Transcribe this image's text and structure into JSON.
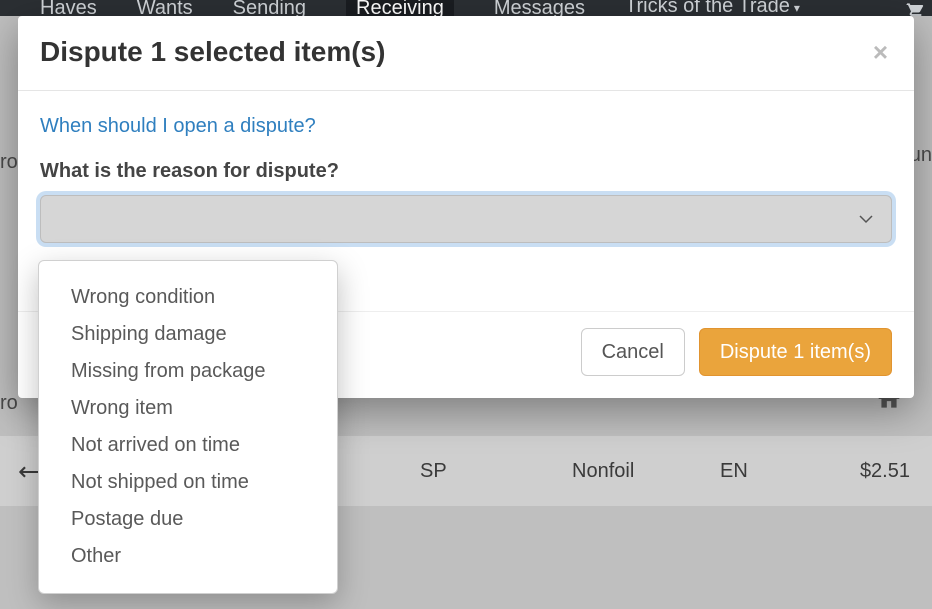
{
  "topnav": {
    "items": [
      "Haves",
      "Wants",
      "Sending",
      "Receiving",
      "Messages",
      "Tricks of the Trade"
    ],
    "active_index": 3,
    "dropdown_index": 5
  },
  "page": {
    "truncated_left_1": "ro",
    "truncated_left_2": "ro",
    "truncated_right_1": "un",
    "row": {
      "condition": "SP",
      "foil": "Nonfoil",
      "lang": "EN",
      "price": "$2.51"
    }
  },
  "modal": {
    "title": "Dispute 1 selected item(s)",
    "help_link": "When should I open a dispute?",
    "form_label": "What is the reason for dispute?",
    "select_value": "",
    "footer": {
      "cancel": "Cancel",
      "submit": "Dispute 1 item(s)"
    }
  },
  "dropdown": {
    "options": [
      "Wrong condition",
      "Shipping damage",
      "Missing from package",
      "Wrong item",
      "Not arrived on time",
      "Not shipped on time",
      "Postage due",
      "Other"
    ]
  }
}
